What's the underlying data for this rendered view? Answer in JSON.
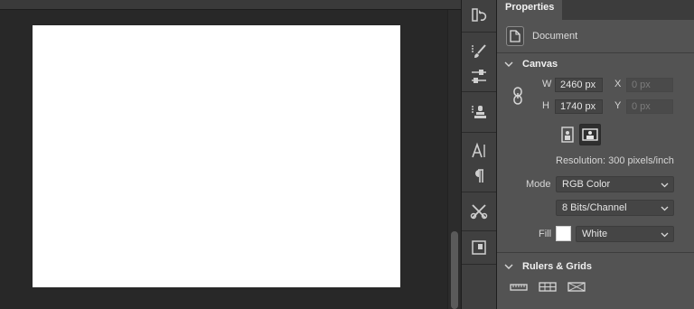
{
  "panel": {
    "tab_title": "Properties",
    "document_label": "Document"
  },
  "canvas": {
    "section_title": "Canvas",
    "width_label": "W",
    "width_value": "2460 px",
    "height_label": "H",
    "height_value": "1740 px",
    "x_label": "X",
    "x_placeholder": "0 px",
    "y_label": "Y",
    "y_placeholder": "0 px",
    "resolution_text": "Resolution: 300 pixels/inch",
    "mode_label": "Mode",
    "mode_value": "RGB Color",
    "bit_depth_value": "8 Bits/Channel",
    "fill_label": "Fill",
    "fill_value": "White",
    "fill_color": "#ffffff"
  },
  "rulers": {
    "section_title": "Rulers & Grids"
  },
  "colors": {
    "workspace_bg": "#282828",
    "panel_bg": "#535353",
    "toolstrip_bg": "#404040",
    "document": "#ffffff"
  },
  "icons": {
    "tools": [
      "history-icon",
      "brush-presets-icon",
      "adjust-sliders-icon",
      "clone-source-icon",
      "character-icon",
      "paragraph-icon",
      "tool-presets-icon",
      "navigator-icon"
    ]
  }
}
